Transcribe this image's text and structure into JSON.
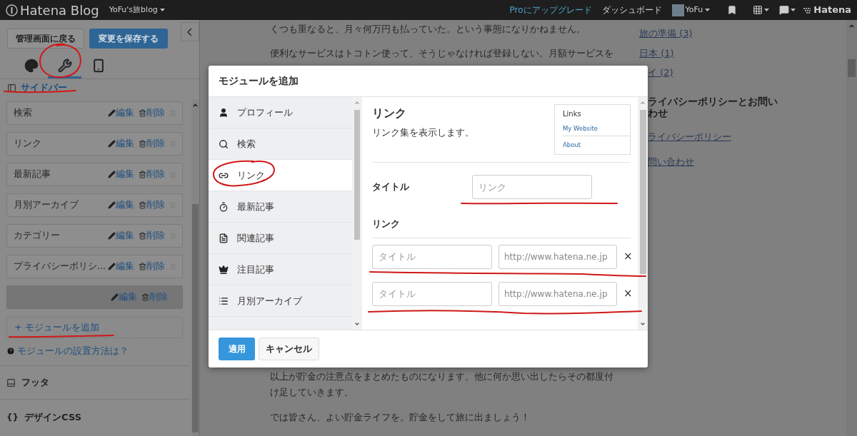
{
  "top_bar": {
    "logo": "Hatena Blog",
    "blog_name": "YoFu's旅blog",
    "upgrade": "Proにアップグレード",
    "dashboard": "ダッシュボード",
    "user": "YoFu",
    "brand": "Hatena"
  },
  "editor": {
    "back_button": "管理画面に戻る",
    "save_button": "変更を保存する",
    "tabs": [
      {
        "kind": "design",
        "selected": false
      },
      {
        "kind": "customize",
        "selected": true
      },
      {
        "kind": "smartphone",
        "selected": false
      }
    ],
    "section_title": "サイドバー",
    "modules": [
      {
        "title": "検索",
        "edit": "編集",
        "delete": "削除",
        "highlighted": false
      },
      {
        "title": "リンク",
        "edit": "編集",
        "delete": "削除",
        "highlighted": false
      },
      {
        "title": "最新記事",
        "edit": "編集",
        "delete": "削除",
        "highlighted": false
      },
      {
        "title": "月別アーカイブ",
        "edit": "編集",
        "delete": "削除",
        "highlighted": false
      },
      {
        "title": "カテゴリー",
        "edit": "編集",
        "delete": "削除",
        "highlighted": false
      },
      {
        "title": "プライバシーポリシ...",
        "edit": "編集",
        "delete": "削除",
        "highlighted": false
      },
      {
        "edit": "編集",
        "delete": "削除",
        "highlighted": true
      }
    ],
    "add_module": "+ モジュールを追加",
    "help_link": "モジュールの設置方法は？",
    "footer_section": "フッタ",
    "css_icon": "{}",
    "css_section": "デザインCSS"
  },
  "article": {
    "top_lines": [
      "くつも重なると、月々何万円も払っていた。という事態になりかねません。",
      "便利なサービスはトコトン使って、そうじゃなければ登録しない。月額サービスを"
    ],
    "bottom_paragraphs": [
      "以上が貯金の注意点をまとめたものになります。他に何か思い出したらその都度付け足していきます。",
      "では皆さん、よい貯金ライフを。貯金をして旅に出ましょう！"
    ]
  },
  "blog_sidebar": {
    "categories": [
      "旅の準備 (3)",
      "日本 (1)",
      "イ (2)"
    ],
    "heading_lines": [
      "ライバシーポリシーとお問い",
      "わせ"
    ],
    "links": [
      "ライバシーポリシー",
      "問い合わせ"
    ]
  },
  "modal": {
    "title": "モジュールを追加",
    "modules": [
      {
        "kind": "profile",
        "label": "プロフィール",
        "selected": false
      },
      {
        "kind": "search",
        "label": "検索",
        "selected": false
      },
      {
        "kind": "link",
        "label": "リンク",
        "selected": true
      },
      {
        "kind": "recent",
        "label": "最新記事",
        "selected": false
      },
      {
        "kind": "related",
        "label": "関連記事",
        "selected": false
      },
      {
        "kind": "featured",
        "label": "注目記事",
        "selected": false
      },
      {
        "kind": "archive",
        "label": "月別アーカイブ",
        "selected": false
      }
    ],
    "detail": {
      "title": "リンク",
      "description": "リンク集を表示します。",
      "preview": {
        "heading": "Links",
        "links": [
          "My Website",
          "About"
        ]
      },
      "title_label": "タイトル",
      "title_placeholder": "リンク",
      "links_label": "リンク",
      "link_rows": [
        {
          "title_placeholder": "タイトル",
          "url_placeholder": "http://www.hatena.ne.jp",
          "remove": "×"
        },
        {
          "title_placeholder": "タイトル",
          "url_placeholder": "http://www.hatena.ne.jp",
          "remove": "×"
        }
      ]
    },
    "apply": "適用",
    "cancel": "キャンセル"
  }
}
